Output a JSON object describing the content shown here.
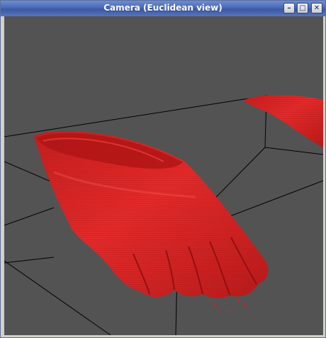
{
  "window": {
    "title": "Camera (Euclidean view)",
    "buttons": {
      "minimize": "–",
      "maximize": "□",
      "close": "✕"
    }
  },
  "viewport": {
    "background": "#535353",
    "mesh_color": "#e02828",
    "grid_color": "#000000"
  }
}
